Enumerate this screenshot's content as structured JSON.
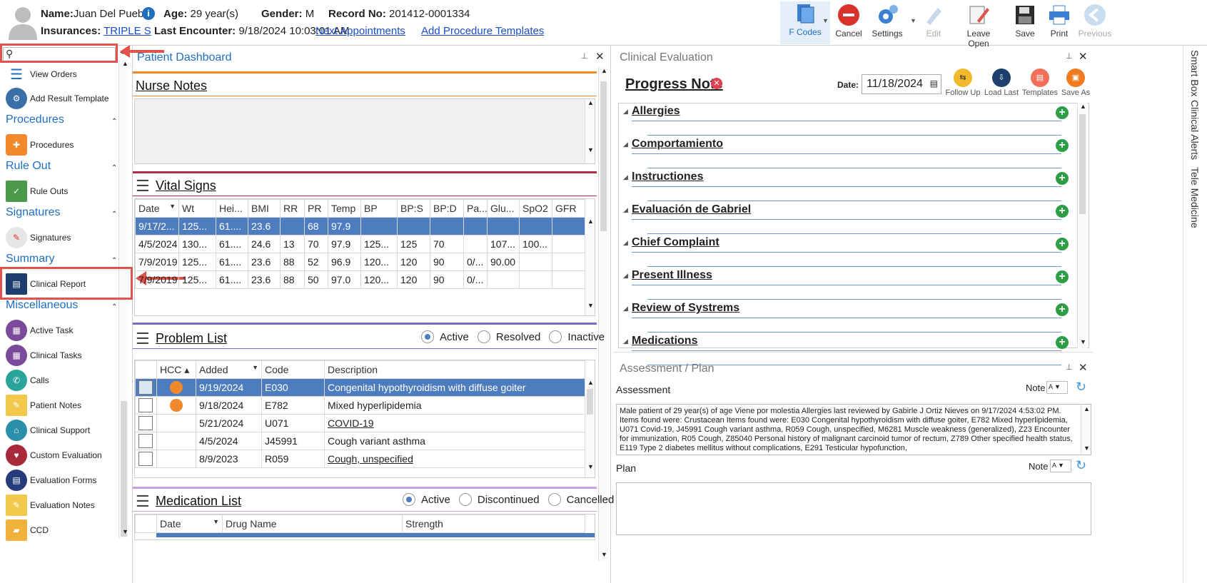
{
  "patient": {
    "name_label": "Name:",
    "name": "Juan Del Pueblo",
    "age_label": "Age:",
    "age": "29 year(s)",
    "gender_label": "Gender:",
    "gender": "M",
    "record_label": "Record No:",
    "record": "201412-0001334",
    "ins_label": "Insurances:",
    "insurance": "TRIPLE S",
    "last_label": "Last Encounter:",
    "last_encounter": "9/18/2024 10:03:01 AM",
    "next_appointments": "Next Appointments",
    "add_procedure_templates": "Add Procedure Templates"
  },
  "toolbar": {
    "fcodes": "F Codes",
    "cancel": "Cancel",
    "settings": "Settings",
    "edit": "Edit",
    "leave_open": "Leave Open",
    "save": "Save",
    "print": "Print",
    "previous": "Previous"
  },
  "sidebar": {
    "search_placeholder": "",
    "view_orders": "View Orders",
    "add_result_template": "Add Result Template",
    "sec_procedures": "Procedures",
    "procedures": "Procedures",
    "sec_ruleout": "Rule Out",
    "rule_outs": "Rule Outs",
    "sec_signatures": "Signatures",
    "signatures": "Signatures",
    "sec_summary": "Summary",
    "clinical_report": "Clinical Report",
    "sec_misc": "Miscellaneous",
    "misc": [
      "Active Task",
      "Clinical Tasks",
      "Calls",
      "Patient Notes",
      "Clinical Support",
      "Custom Evaluation",
      "Evaluation Forms",
      "Evaluation Notes",
      "CCD"
    ]
  },
  "dashboard": {
    "title": "Patient Dashboard",
    "nurse_notes": "Nurse Notes",
    "vital_signs": "Vital Signs",
    "vitals_headers": [
      "Date",
      "Wt",
      "Hei...",
      "BMI",
      "RR",
      "PR",
      "Temp",
      "BP",
      "BP:S",
      "BP:D",
      "Pa...",
      "Glu...",
      "SpO2",
      "GFR"
    ],
    "vitals_rows": [
      [
        "9/17/2...",
        "125...",
        "61....",
        "23.6",
        "",
        "68",
        "97.9",
        "",
        "",
        "",
        "",
        "",
        "",
        ""
      ],
      [
        "4/5/2024",
        "130...",
        "61....",
        "24.6",
        "13",
        "70",
        "97.9",
        "125...",
        "125",
        "70",
        "",
        "107...",
        "100...",
        ""
      ],
      [
        "7/9/2019",
        "125...",
        "61....",
        "23.6",
        "88",
        "52",
        "96.9",
        "120...",
        "120",
        "90",
        "0/...",
        "90.00",
        "",
        ""
      ],
      [
        "7/9/2019",
        "125...",
        "61....",
        "23.6",
        "88",
        "50",
        "97.0",
        "120...",
        "120",
        "90",
        "0/...",
        "",
        "",
        ""
      ]
    ],
    "problem_list": "Problem List",
    "pl_active": "Active",
    "pl_resolved": "Resolved",
    "pl_inactive": "Inactive",
    "pl_headers": [
      "",
      "HCC",
      "Added",
      "Code",
      "Description"
    ],
    "pl_rows": [
      {
        "dot": true,
        "added": "9/19/2024",
        "code": "E030",
        "desc": "Congenital hypothyroidism with diffuse goiter"
      },
      {
        "dot": true,
        "added": "9/18/2024",
        "code": "E782",
        "desc": "Mixed hyperlipidemia"
      },
      {
        "dot": false,
        "added": "5/21/2024",
        "code": "U071",
        "desc": "COVID-19"
      },
      {
        "dot": false,
        "added": "4/5/2024",
        "code": "J45991",
        "desc": "Cough variant asthma"
      },
      {
        "dot": false,
        "added": "8/9/2023",
        "code": "R059",
        "desc": "Cough, unspecified"
      }
    ],
    "medication_list": "Medication List",
    "ml_active": "Active",
    "ml_discontinued": "Discontinued",
    "ml_cancelled": "Cancelled",
    "ml_headers": [
      "",
      "Date",
      "Drug Name",
      "Strength"
    ]
  },
  "clinical": {
    "title": "Clinical Evaluation",
    "note_title": "Progress Note",
    "date_label": "Date:",
    "date": "11/18/2024",
    "follow_up": "Follow Up",
    "load_last": "Load Last",
    "templates": "Templates",
    "save_as": "Save As",
    "sections": [
      "Allergies",
      "Comportamiento",
      "Instructiones",
      "Evaluación de Gabriel",
      "Chief Complaint",
      "Present Illness",
      "Review of Systrems",
      "Medications"
    ]
  },
  "assessment": {
    "title": "Assessment / Plan",
    "assessment_label": "Assessment",
    "note_label": "Note",
    "plan_label": "Plan",
    "text": "Male patient of 29 year(s) of age Viene por molestia     Allergies last reviewed by Gabirle J Ortiz Nieves on 9/17/2024 4:53:02 PM.    Items found were:  Crustacean  Items found were:  E030 Congenital hypothyroidism with diffuse goiter, E782 Mixed hyperlipidemia, U071 Covid-19, J45991 Cough variant asthma, R059 Cough, unspecified, M6281 Muscle weakness (generalized), Z23 Encounter for immunization, R05 Cough, Z85040 Personal history of malignant carcinoid tumor of rectum, Z789 Other specified health status, E119 Type 2 diabetes mellitus without complications, E291 Testicular hypofunction,"
  },
  "right_tabs": [
    "Smart Box",
    "Clinical Alerts",
    "Tele Medicine"
  ],
  "colors": {
    "accent": "#1f6fc0",
    "selected_row": "#4e7dbf",
    "highlight": "#e0524a",
    "hcc_dot": "#f0882c"
  }
}
